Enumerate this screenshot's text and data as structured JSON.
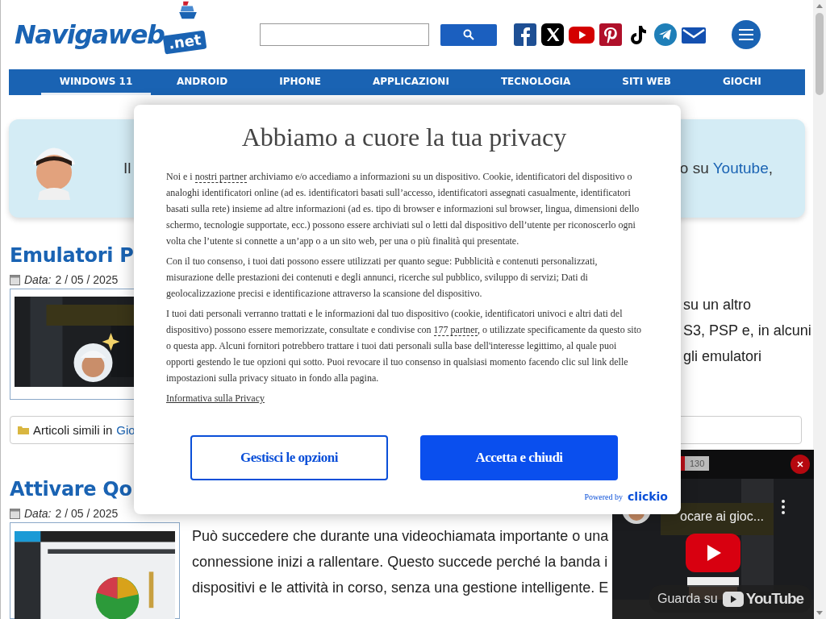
{
  "header": {
    "logo": {
      "name": "Navigaweb",
      "suffix": ".net"
    }
  },
  "nav": [
    {
      "label": "WINDOWS 11",
      "selected": true
    },
    {
      "label": "ANDROID",
      "selected": false
    },
    {
      "label": "IPHONE",
      "selected": false
    },
    {
      "label": "APPLICAZIONI",
      "selected": false
    },
    {
      "label": "TECNOLOGIA",
      "selected": false
    },
    {
      "label": "SITI WEB",
      "selected": false
    },
    {
      "label": "GIOCHI",
      "selected": false
    }
  ],
  "banner": {
    "text_start": "Il",
    "text_end": "o su ",
    "link": "Youtube",
    "text_after": ","
  },
  "articles": [
    {
      "title": "Emulatori P",
      "date_label": "Data:",
      "date": "2 / 05 / 2025",
      "body_fragments": [
        "su un altro",
        "S3, PSP e, in alcuni",
        "gli emulatori"
      ],
      "related": {
        "label": "Articoli simili in ",
        "link": "Gio"
      }
    },
    {
      "title": "Attivare Qo",
      "date_label": "Data:",
      "date": "2 / 05 / 2025",
      "body_lines": [
        "Può succedere che durante una videochiamata importante o una",
        "connessione inizi a rallentare. Questo succede perché la banda i",
        "dispositivi e le attività in corso, senza una gestione intelligente. E"
      ]
    }
  ],
  "consent": {
    "title": "Abbiamo a cuore la tua privacy",
    "paragraphs": [
      [
        {
          "text": "Noi e i "
        },
        {
          "link": "nostri partner"
        },
        {
          "text": " archiviamo e/o accediamo a informazioni su un dispositivo. Cookie, identificatori del dispositivo o analoghi identificatori online (ad es. identificatori basati sull’accesso, identificatori assegnati casualmente, identificatori basati sulla rete) insieme ad altre informazioni (ad es. tipo di browser e informazioni sul browser, lingua, dimensioni dello schermo, tecnologie supportate, ecc.) possono essere archiviati sul o letti dal dispositivo dell’utente per riconoscerlo ogni volta che l’utente si connette a un’app o a un sito web, per una o più finalità qui presentate."
        }
      ],
      [
        {
          "text": "Con il tuo consenso, i tuoi dati possono essere utilizzati per quanto segue: Pubblicità e contenuti personalizzati, misurazione delle prestazioni dei contenuti e degli annunci, ricerche sul pubblico, sviluppo di servizi; Dati di geolocalizzazione precisi e identificazione attraverso la scansione del dispositivo."
        }
      ],
      [
        {
          "text": "I tuoi dati personali verranno trattati e le informazioni dal tuo dispositivo (cookie, identificatori univoci e altri dati del dispositivo) possono essere memorizzate, consultate e condivise con "
        },
        {
          "link": "177 partner"
        },
        {
          "text": ", o utilizzate specificamente da questo sito o questa app. Alcuni fornitori potrebbero trattare i tuoi dati personali sulla base dell'interesse legittimo, al quale puoi opporti gestendo le tue opzioni qui sotto. Puoi revocare il tuo consenso in qualsiasi momento facendo clic sul link delle impostazioni sulla privacy situato in fondo alla pagina."
        }
      ]
    ],
    "privacy_link": "Informativa sulla Privacy",
    "buttons": [
      {
        "label": "Gestisci le opzioni",
        "kind": "outline"
      },
      {
        "label": "Accetta e chiudi",
        "kind": "primary"
      }
    ],
    "powered_by": "Powered by",
    "brand": "clickio"
  },
  "video": {
    "count": "130",
    "title": "ocare ai gioc...",
    "watch_on": "Guarda su",
    "platform": "YouTube"
  }
}
